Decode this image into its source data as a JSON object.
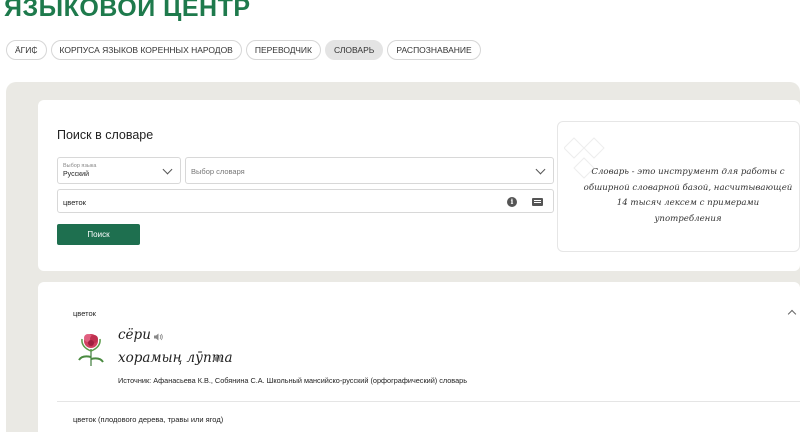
{
  "header": {
    "brand": "ЯЗЫКОВОЙ ЦЕНТР"
  },
  "nav": {
    "tabs": [
      {
        "label": "ӒГИ₵",
        "active": false
      },
      {
        "label": "КОРПУСА ЯЗЫКОВ КОРЕННЫХ НАРОДОВ",
        "active": false
      },
      {
        "label": "ПЕРЕВОДЧИК",
        "active": false
      },
      {
        "label": "СЛОВАРЬ",
        "active": true
      },
      {
        "label": "РАСПОЗНАВАНИЕ",
        "active": false
      }
    ]
  },
  "search": {
    "title": "Поиск в словаре",
    "language_label": "Выбор языка",
    "language_value": "Русский",
    "dictionary_placeholder": "Выбор словаря",
    "query_value": "цветок",
    "button_label": "Поиск"
  },
  "info": {
    "text": "Словарь - это инструмент для работы с обширной словарной базой, насчитывающей 14 тысяч лексем с примерами употребления"
  },
  "results": [
    {
      "headword": "цветок",
      "translations": [
        "сёри",
        "хорамың лӯпта"
      ],
      "source": "Источник: Афанасьева К.В., Собянина С.А. Школьный мансийско-русский (орфографический) словарь"
    },
    {
      "headword": "цветок (плодового дерева, травы или ягод)"
    }
  ],
  "colors": {
    "brand": "#1e7a4c",
    "button": "#1e6f4f",
    "panel": "#eae9e4"
  }
}
